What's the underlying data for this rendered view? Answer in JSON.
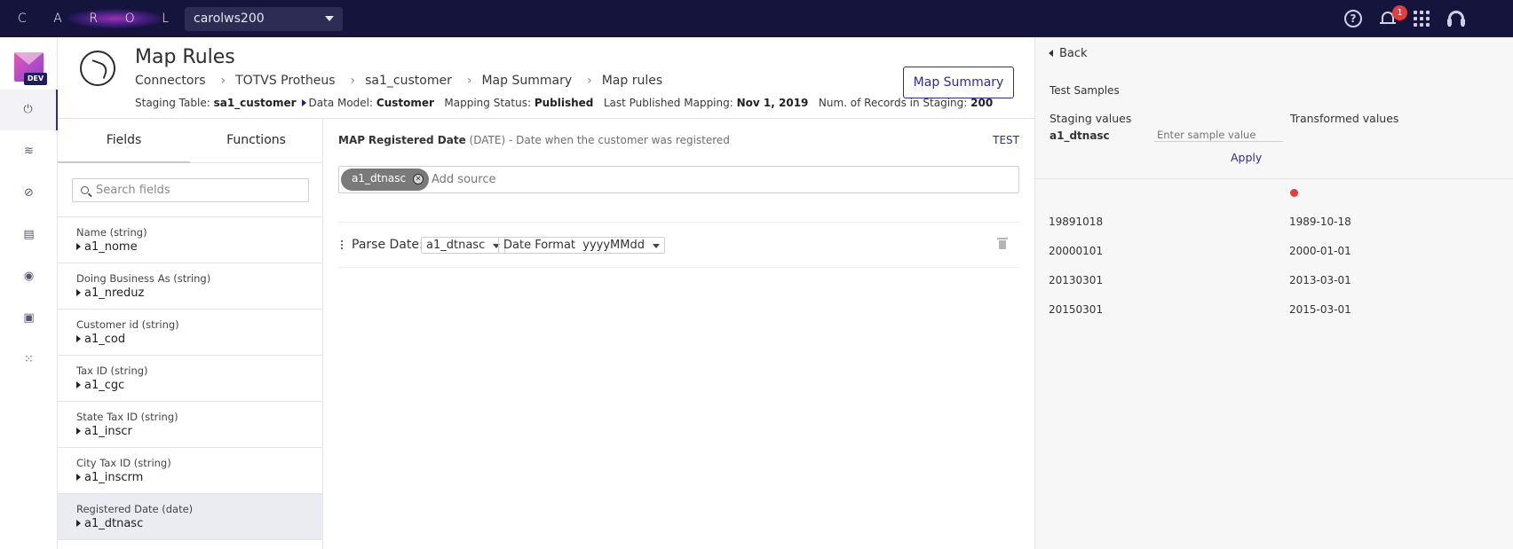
{
  "topbar": {
    "logo_letters": [
      "C",
      "A",
      "R",
      "O",
      "L"
    ],
    "tenant": "carolws200",
    "notification_count": "1"
  },
  "rail": {
    "env_badge": "DEV",
    "items": [
      {
        "name": "connectors",
        "icon": "plug-icon",
        "glyph": "⏻",
        "active": true
      },
      {
        "name": "data",
        "icon": "database-icon",
        "glyph": "≋"
      },
      {
        "name": "explore",
        "icon": "compass-icon",
        "glyph": "⊘"
      },
      {
        "name": "analytics",
        "icon": "chart-icon",
        "glyph": "▤"
      },
      {
        "name": "integrations",
        "icon": "cycle-icon",
        "glyph": "◉"
      },
      {
        "name": "processing",
        "icon": "chip-icon",
        "glyph": "▣"
      },
      {
        "name": "apps",
        "icon": "app-settings-icon",
        "glyph": "⁙"
      }
    ]
  },
  "header": {
    "title": "Map Rules",
    "breadcrumb": [
      "Connectors",
      "TOTVS Protheus",
      "sa1_customer",
      "Map Summary",
      "Map rules"
    ],
    "staging_table_label": "Staging Table:",
    "staging_table": "sa1_customer",
    "data_model_label": "Data Model:",
    "data_model": "Customer",
    "mapping_status_label": "Mapping Status:",
    "mapping_status": "Published",
    "last_published_label": "Last Published Mapping:",
    "last_published": "Nov 1, 2019",
    "records_label": "Num. of Records in Staging:",
    "records": "200",
    "summary_button": "Map Summary"
  },
  "fields_panel": {
    "tabs": [
      "Fields",
      "Functions"
    ],
    "active_tab": "Fields",
    "search_placeholder": "Search fields",
    "items": [
      {
        "type": "Name (string)",
        "field": "a1_nome"
      },
      {
        "type": "Doing Business As (string)",
        "field": "a1_nreduz"
      },
      {
        "type": "Customer id (string)",
        "field": "a1_cod"
      },
      {
        "type": "Tax ID (string)",
        "field": "a1_cgc"
      },
      {
        "type": "State Tax ID (string)",
        "field": "a1_inscr"
      },
      {
        "type": "City Tax ID (string)",
        "field": "a1_inscrm"
      },
      {
        "type": "Registered Date (date)",
        "field": "a1_dtnasc",
        "selected": true
      }
    ]
  },
  "mapping": {
    "map_prefix": "MAP",
    "field_name": "Registered Date",
    "field_type": "(DATE)",
    "field_desc": "- Date when the customer was registered",
    "test_link": "TEST",
    "source_chip": "a1_dtnasc",
    "add_source_placeholder": "Add source",
    "function_label": "Parse Date:",
    "function_source": "a1_dtnasc",
    "date_format_label": "Date Format",
    "date_format_value": "yyyyMMdd"
  },
  "test_panel": {
    "back": "Back",
    "title": "Test Samples",
    "staging_header": "Staging values",
    "transformed_header": "Transformed values",
    "sample_field": "a1_dtnasc",
    "sample_placeholder": "Enter sample value",
    "apply": "Apply",
    "rows": [
      {
        "staging": "19891018",
        "transformed": "1989-10-18"
      },
      {
        "staging": "20000101",
        "transformed": "2000-01-01"
      },
      {
        "staging": "20130301",
        "transformed": "2013-03-01"
      },
      {
        "staging": "20150301",
        "transformed": "2015-03-01"
      }
    ]
  },
  "colors": {
    "topbar": "#14143d",
    "accent": "#2d2d8f",
    "error": "#e83b3b"
  }
}
